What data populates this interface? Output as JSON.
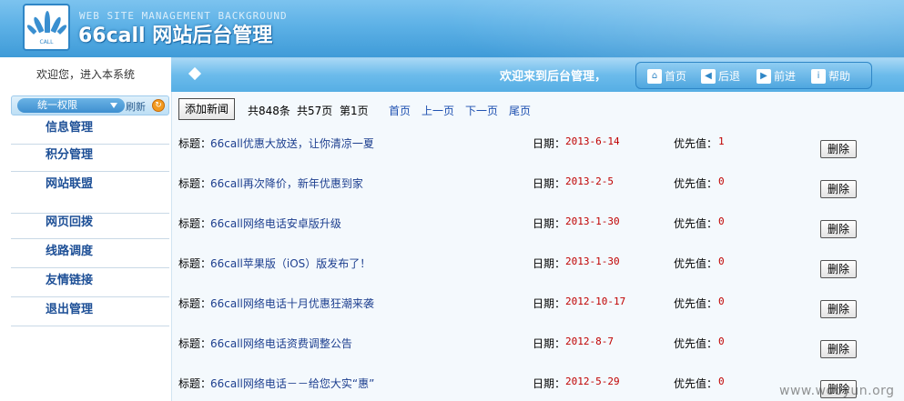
{
  "header": {
    "subtitle": "WEB SITE MANAGEMENT BACKGROUND",
    "title": "66call 网站后台管理",
    "logo_text": "CALL"
  },
  "sidebar": {
    "welcome": "欢迎您，进入本系统",
    "permission": "统一权限",
    "refresh": "刷新",
    "items": [
      {
        "label": "信息管理"
      },
      {
        "label": "积分管理"
      },
      {
        "label": "网站联盟"
      },
      {
        "label": "网页回拨"
      },
      {
        "label": "线路调度"
      },
      {
        "label": "友情链接"
      },
      {
        "label": "退出管理"
      }
    ]
  },
  "topbar": {
    "welcome": "欢迎来到后台管理，",
    "buttons": [
      {
        "label": "首页",
        "icon": "home-icon"
      },
      {
        "label": "后退",
        "icon": "back-icon"
      },
      {
        "label": "前进",
        "icon": "forward-icon"
      },
      {
        "label": "帮助",
        "icon": "help-icon"
      }
    ]
  },
  "toolbar": {
    "add_label": "添加新闻",
    "total": "共848条",
    "pages": "共57页",
    "current": "第1页",
    "first": "首页",
    "prev": "上一页",
    "next": "下一页",
    "last": "尾页"
  },
  "labels": {
    "title": "标题：",
    "date": "日期：",
    "priority": "优先值：",
    "delete": "删除"
  },
  "news": [
    {
      "title": "66call优惠大放送，让你清凉一夏",
      "date": "2013-6-14",
      "priority": "1"
    },
    {
      "title": "66call再次降价，新年优惠到家",
      "date": "2013-2-5",
      "priority": "0"
    },
    {
      "title": "66call网络电话安卓版升级",
      "date": "2013-1-30",
      "priority": "0"
    },
    {
      "title": "66call苹果版（iOS）版发布了！",
      "date": "2013-1-30",
      "priority": "0"
    },
    {
      "title": "66call网络电话十月优惠狂潮来袭",
      "date": "2012-10-17",
      "priority": "0"
    },
    {
      "title": "66call网络电话资费调整公告",
      "date": "2012-8-7",
      "priority": "0"
    },
    {
      "title": "66call网络电话－－给您大实“惠”",
      "date": "2012-5-29",
      "priority": "0"
    }
  ],
  "watermark": "www.wooyun.org",
  "colors": {
    "accent": "#3f9bd8",
    "link": "#1d3f8f",
    "date": "#c00000"
  }
}
